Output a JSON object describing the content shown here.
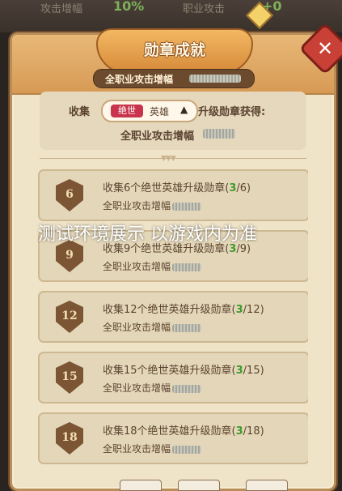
{
  "background": {
    "left_label": "攻击增幅",
    "left_value": "10%",
    "right_label": "职业攻击",
    "right_value": "+0"
  },
  "title": "勋章成就",
  "subtitle": "全职业攻击增幅",
  "close_icon": "close-icon",
  "collect": {
    "label": "收集",
    "tag": "绝世",
    "hero": "英雄",
    "dropdown_icon": "▲",
    "upgrade_label": "升级勋章获得:",
    "reward": "全职业攻击增幅"
  },
  "watermark": "测试环境展示 以游戏内为准",
  "rows": [
    {
      "badge": "6",
      "text_a": "收集6个绝世英雄升级勋章(",
      "progress": "3",
      "text_b": "/6)",
      "reward": "全职业攻击增幅"
    },
    {
      "badge": "9",
      "text_a": "收集9个绝世英雄升级勋章(",
      "progress": "3",
      "text_b": "/9)",
      "reward": "全职业攻击增幅"
    },
    {
      "badge": "12",
      "text_a": "收集12个绝世英雄升级勋章(",
      "progress": "3",
      "text_b": "/12)",
      "reward": "全职业攻击增幅"
    },
    {
      "badge": "15",
      "text_a": "收集15个绝世英雄升级勋章(",
      "progress": "3",
      "text_b": "/15)",
      "reward": "全职业攻击增幅"
    },
    {
      "badge": "18",
      "text_a": "收集18个绝世英雄升级勋章(",
      "progress": "3",
      "text_b": "/18)",
      "reward": "全职业攻击增幅"
    }
  ]
}
